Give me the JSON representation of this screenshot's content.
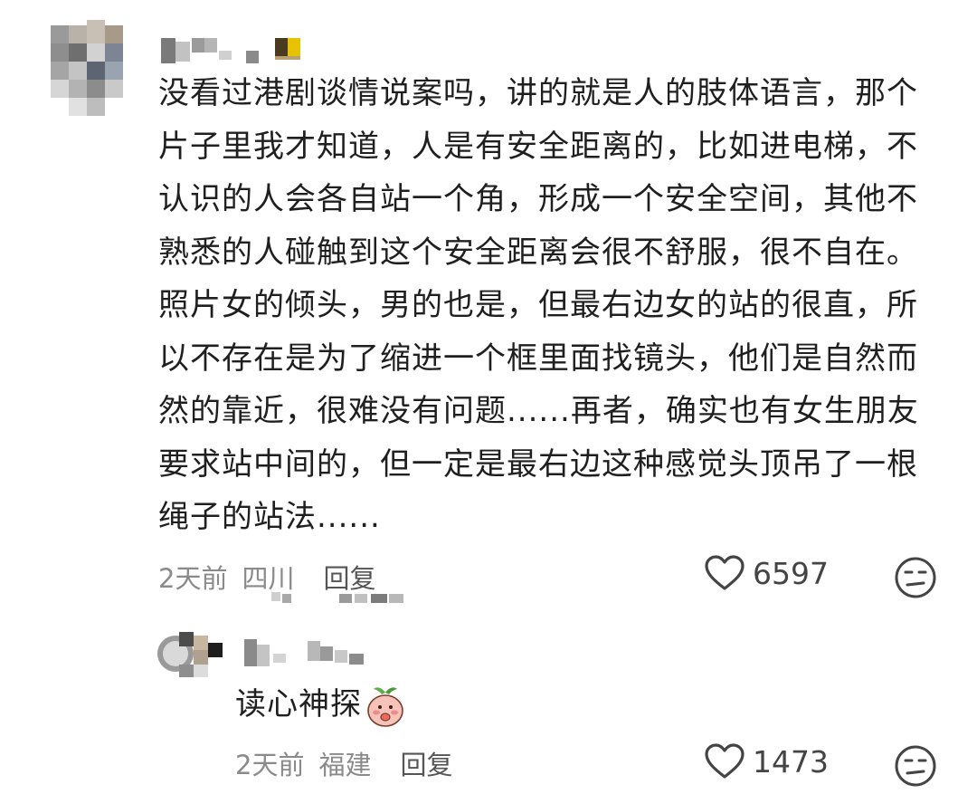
{
  "comments": [
    {
      "text": "没看过港剧谈情说案吗，讲的就是人的肢体语言，那个片子里我才知道，人是有安全距离的，比如进电梯，不认识的人会各自站一个角，形成一个安全空间，其他不熟悉的人碰触到这个安全距离会很不舒服，很不自在。照片女的倾头，男的也是，但最右边女的站的很直，所以不存在是为了缩进一个框里面找镜头，他们是自然而然的靠近，很难没有问题......再者，确实也有女生朋友要求站中间的，但一定是最右边这种感觉头顶吊了一根绳子的站法......",
      "time": "2天前",
      "region": "四川",
      "reply_label": "回复",
      "likes": "6597"
    },
    {
      "text": "读心神探",
      "sticker": "peach-sticker-icon",
      "time": "2天前",
      "region": "福建",
      "reply_label": "回复",
      "likes": "1473"
    }
  ],
  "icons": {
    "like": "heart-outline-icon",
    "dislike": "meh-face-icon"
  }
}
